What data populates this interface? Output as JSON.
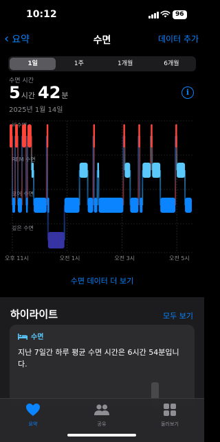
{
  "status_bar": {
    "time": "10:12",
    "battery": "96"
  },
  "nav": {
    "back_label": "요약",
    "title": "수면",
    "action_label": "데이터 추가"
  },
  "segments": [
    {
      "label": "1일",
      "active": true
    },
    {
      "label": "1주",
      "active": false
    },
    {
      "label": "1개월",
      "active": false
    },
    {
      "label": "6개월",
      "active": false
    }
  ],
  "summary": {
    "label": "수면 시간",
    "hours": "5",
    "hours_unit": "시간",
    "minutes": "42",
    "minutes_unit": "분",
    "date": "2025년 1월 14일"
  },
  "colors": {
    "awake": "#ff453a",
    "rem": "#5ac8fa",
    "core": "#0a84ff",
    "deep": "#3634a3",
    "accent": "#0a84ff"
  },
  "chart_data": {
    "type": "timeline",
    "stages": [
      "비수면",
      "REM 수면",
      "코어 수면",
      "깊은 수면"
    ],
    "x_ticks": [
      "오후 11시",
      "오전 1시",
      "오전 3시",
      "오전 5시"
    ],
    "time_range_hours": [
      22.9,
      29.6
    ],
    "segments": [
      {
        "stage": "비수면",
        "start": 22.9,
        "end": 23.0
      },
      {
        "stage": "코어 수면",
        "start": 23.0,
        "end": 23.1
      },
      {
        "stage": "비수면",
        "start": 23.1,
        "end": 23.2
      },
      {
        "stage": "코어 수면",
        "start": 23.2,
        "end": 23.35
      },
      {
        "stage": "비수면",
        "start": 23.35,
        "end": 23.5
      },
      {
        "stage": "코어 수면",
        "start": 23.5,
        "end": 23.55
      },
      {
        "stage": "비수면",
        "start": 23.55,
        "end": 23.7
      },
      {
        "stage": "REM 수면",
        "start": 23.7,
        "end": 23.78
      },
      {
        "stage": "코어 수면",
        "start": 23.78,
        "end": 24.25
      },
      {
        "stage": "비수면",
        "start": 24.25,
        "end": 24.28
      },
      {
        "stage": "코어 수면",
        "start": 24.28,
        "end": 24.3
      },
      {
        "stage": "깊은 수면",
        "start": 24.3,
        "end": 24.9
      },
      {
        "stage": "코어 수면",
        "start": 24.9,
        "end": 25.45
      },
      {
        "stage": "REM 수면",
        "start": 25.45,
        "end": 25.75
      },
      {
        "stage": "코어 수면",
        "start": 25.75,
        "end": 25.95
      },
      {
        "stage": "비수면",
        "start": 25.95,
        "end": 25.98
      },
      {
        "stage": "코어 수면",
        "start": 25.98,
        "end": 26.1
      },
      {
        "stage": "REM 수면",
        "start": 26.1,
        "end": 26.15
      },
      {
        "stage": "코어 수면",
        "start": 26.15,
        "end": 27.05
      },
      {
        "stage": "비수면",
        "start": 27.05,
        "end": 27.1
      },
      {
        "stage": "REM 수면",
        "start": 27.1,
        "end": 27.3
      },
      {
        "stage": "코어 수면",
        "start": 27.3,
        "end": 27.6
      },
      {
        "stage": "비수면",
        "start": 27.6,
        "end": 27.65
      },
      {
        "stage": "코어 수면",
        "start": 27.65,
        "end": 27.75
      },
      {
        "stage": "REM 수면",
        "start": 27.75,
        "end": 28.05
      },
      {
        "stage": "비수면",
        "start": 28.05,
        "end": 28.1
      },
      {
        "stage": "REM 수면",
        "start": 28.1,
        "end": 28.4
      },
      {
        "stage": "코어 수면",
        "start": 28.4,
        "end": 28.95
      },
      {
        "stage": "비수면",
        "start": 28.95,
        "end": 29.0
      },
      {
        "stage": "REM 수면",
        "start": 29.0,
        "end": 29.3
      },
      {
        "stage": "코어 수면",
        "start": 29.3,
        "end": 29.55
      }
    ]
  },
  "more_link": "수면 데이터 더 보기",
  "highlights": {
    "title": "하이라이트",
    "show_all": "모두 보기",
    "card": {
      "category": "수면",
      "text": "지난 7일간 하루 평균 수면 시간은 6시간 54분입니다."
    }
  },
  "tabbar": [
    {
      "label": "요약",
      "icon": "heart-icon",
      "active": true
    },
    {
      "label": "공유",
      "icon": "people-icon",
      "active": false
    },
    {
      "label": "둘러보기",
      "icon": "grid-icon",
      "active": false
    }
  ]
}
